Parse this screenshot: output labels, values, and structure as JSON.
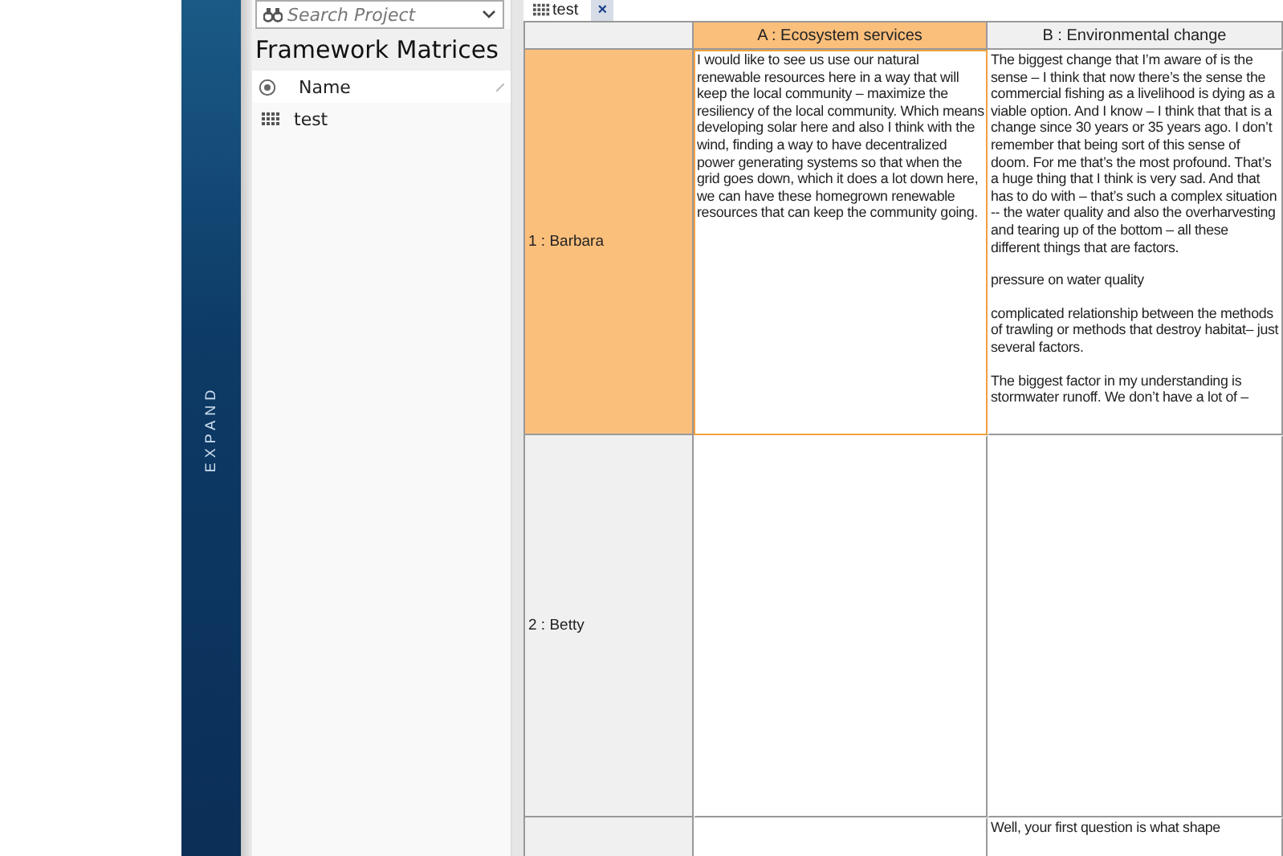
{
  "side_strip": {
    "label": "EXPAND"
  },
  "project_panel": {
    "search": {
      "placeholder": "Search Project"
    },
    "title": "Framework Matrices",
    "list_header": "Name",
    "items": [
      {
        "label": "test",
        "selected": false
      }
    ]
  },
  "tabs": [
    {
      "label": "test",
      "selected": true,
      "close": "×"
    }
  ],
  "matrix": {
    "columns": [
      {
        "label": "A : Ecosystem services",
        "selected": true
      },
      {
        "label": "B : Environmental change",
        "selected": false
      }
    ],
    "rows": [
      {
        "header": "1 : Barbara",
        "selected": true,
        "cells": [
          [
            "I would like to see us use our natural renewable resources here in a way that will keep the local community – maximize the resiliency of the local community. Which means developing solar here and also I think with the wind, finding a way to have decentralized power generating systems so that when the grid goes down, which it does a lot down here, we can have these homegrown renewable resources that can keep the community going."
          ],
          [
            "The biggest change that I’m aware of is the sense – I think that now there’s the sense the commercial fishing as a livelihood is dying as a viable option. And I know – I think that that is a change since 30 years or 35 years ago. I don’t remember that being sort of this sense of doom. For me that’s the most profound. That’s a huge thing that I think is very sad. And that has to do with – that’s such a complex situation -- the water quality and also the overharvesting and tearing up of the bottom – all these different things that are factors.",
            "pressure on water quality",
            "complicated relationship between the methods of trawling or methods that destroy habitat– just several factors.",
            "The biggest factor in my understanding is stormwater runoff. We don’t have a lot of –"
          ]
        ]
      },
      {
        "header": "2 : Betty",
        "selected": false,
        "cells": [
          [],
          []
        ]
      },
      {
        "selected": false,
        "cells": [
          [],
          [
            "Well, your first question is what shape"
          ]
        ]
      }
    ]
  }
}
